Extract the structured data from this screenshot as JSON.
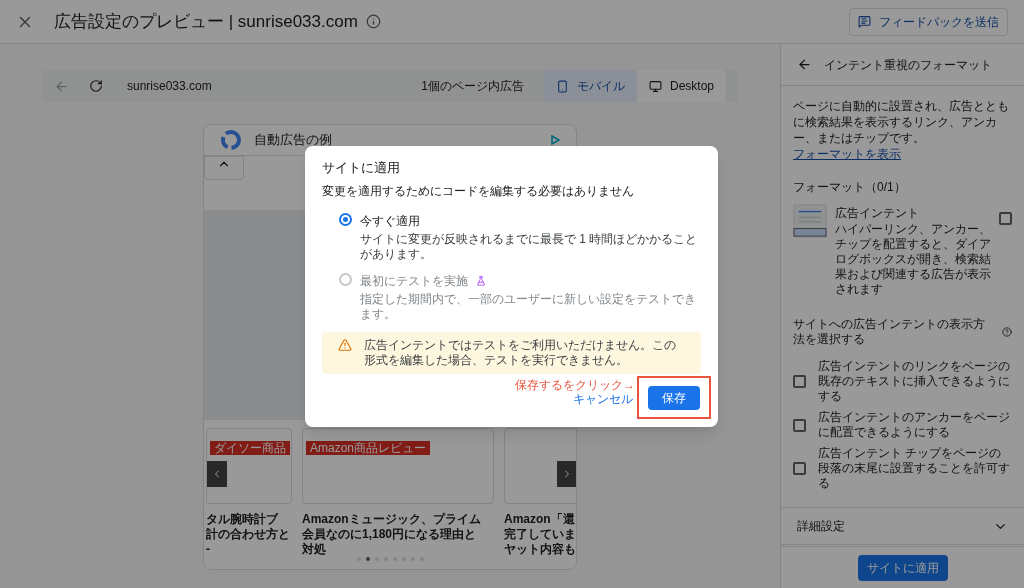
{
  "header": {
    "title": "広告設定のプレビュー | sunrise033.com",
    "feedback_button": "フィードバックを送信"
  },
  "preview_toolbar": {
    "url": "sunrise033.com",
    "ad_count": "1個のページ内広告",
    "devices": [
      {
        "label": "モバイル",
        "kind": "mobile",
        "selected": true
      },
      {
        "label": "Desktop",
        "kind": "desktop",
        "selected": false
      }
    ]
  },
  "phone": {
    "banner_title": "自動広告の例",
    "cards": [
      {
        "tag": "ダイソー商品",
        "title_lines": [
          "タル腕時計ブ",
          "計の合わせ方と",
          "-"
        ]
      },
      {
        "tag": "Amazon商品レビュー",
        "title_lines": [
          "Amazonミュージック、プライム",
          "会員なのに1,180円になる理由と",
          "対処"
        ]
      },
      {
        "title_lines": [
          "Amazon「還",
          "完了していま",
          "ヤット内容も"
        ]
      }
    ],
    "dots": [
      {
        "selected": false
      },
      {
        "selected": true
      },
      {
        "selected": false
      },
      {
        "selected": false
      },
      {
        "selected": false
      },
      {
        "selected": false
      },
      {
        "selected": false
      },
      {
        "selected": false
      }
    ]
  },
  "side_panel": {
    "title": "インテント重視のフォーマット",
    "description": "ページに自動的に設置され、広告とともに検索結果を表示するリンク、アンカー、またはチップです。",
    "description_link": "フォーマットを表示",
    "formats_heading": "フォーマット（0/1）",
    "format": {
      "name": "広告インテント",
      "description": "ハイパーリンク、アンカー、チップを配置すると、ダイアログボックスが開き、検索結果および関連する広告が表示されます",
      "checked": false
    },
    "options_heading": "サイトへの広告インテントの表示方法を選択する",
    "options": [
      {
        "label": "広告インテントのリンクをページの既存のテキストに挿入できるようにする",
        "checked": false
      },
      {
        "label": "広告インテントのアンカーをページに配置できるようにする",
        "checked": false
      },
      {
        "label": "広告インテント チップをページの段落の末尾に設置することを許可する",
        "checked": false
      }
    ],
    "advanced": {
      "label": "詳細設定",
      "expanded": false
    },
    "apply_button": "サイトに適用"
  },
  "dialog": {
    "title": "サイトに適用",
    "subtitle": "変更を適用するためにコードを編集する必要はありません",
    "options": [
      {
        "label": "今すぐ適用",
        "description": "サイトに変更が反映されるまでに最長で 1 時間ほどかかることがあります。",
        "selected": true,
        "disabled": false,
        "beta": false
      },
      {
        "label": "最初にテストを実施",
        "description": "指定した期間内で、一部のユーザーに新しい設定をテストできます。",
        "selected": false,
        "disabled": true,
        "beta": true
      }
    ],
    "warning": "広告インテントではテストをご利用いただけません。この形式を編集した場合、テストを実行できません。",
    "cancel_button": "キャンセル",
    "save_button": "保存"
  },
  "annotation": {
    "text": "保存するをクリック→"
  }
}
